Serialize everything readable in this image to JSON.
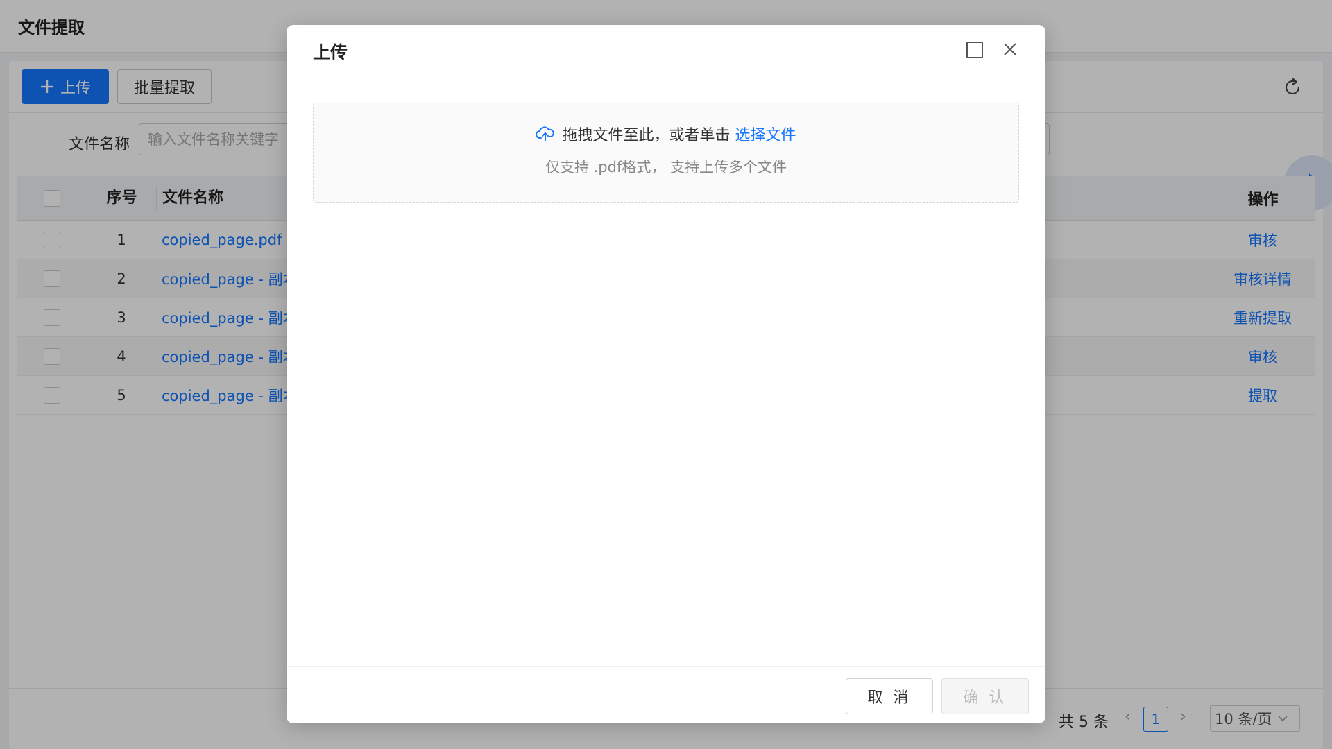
{
  "page": {
    "title": "文件提取"
  },
  "toolbar": {
    "upload_label": "上传",
    "batch_label": "批量提取"
  },
  "filter": {
    "label": "文件名称",
    "placeholder": "输入文件名称关键字"
  },
  "table": {
    "headers": {
      "index": "序号",
      "name": "文件名称",
      "action": "操作"
    },
    "rows": [
      {
        "index": "1",
        "name": "copied_page.pdf",
        "action": "审核"
      },
      {
        "index": "2",
        "name": "copied_page - 副本",
        "action": "审核详情"
      },
      {
        "index": "3",
        "name": "copied_page - 副本",
        "action": "重新提取"
      },
      {
        "index": "4",
        "name": "copied_page - 副本",
        "action": "审核"
      },
      {
        "index": "5",
        "name": "copied_page - 副本",
        "action": "提取"
      }
    ]
  },
  "pagination": {
    "total": "共 5 条",
    "current": "1",
    "page_size": "10 条/页"
  },
  "dialog": {
    "title": "上传",
    "drop_text": "拖拽文件至此，或者单击",
    "select_link": "选择文件",
    "hint": "仅支持 .pdf格式， 支持上传多个文件",
    "cancel_label": "取 消",
    "confirm_label": "确 认"
  },
  "colors": {
    "accent": "#1677ff",
    "mask": "rgba(0,0,0,0.3)"
  }
}
